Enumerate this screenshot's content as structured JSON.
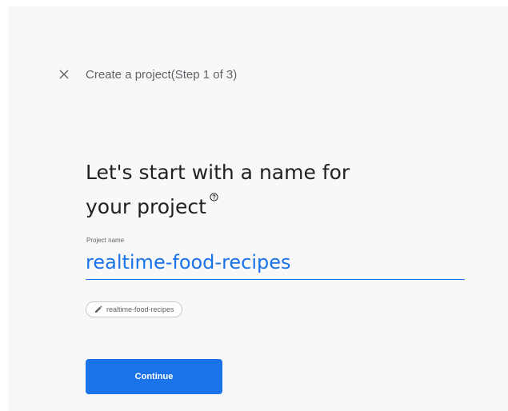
{
  "header": {
    "title": "Create a project(Step 1 of 3)",
    "close_icon": "close-icon"
  },
  "heading": {
    "line1": "Let's start with a name for",
    "line2": "your project",
    "help_icon": "help-circle-icon"
  },
  "project_name_field": {
    "label": "Project name",
    "value": "realtime-food-recipes"
  },
  "project_id_chip": {
    "icon": "pencil-icon",
    "label": "realtime-food-recipes"
  },
  "actions": {
    "continue_label": "Continue"
  },
  "colors": {
    "accent": "#1a73e8",
    "background": "#f8f8f8",
    "text_primary": "#202124",
    "text_secondary": "#5f6368"
  }
}
